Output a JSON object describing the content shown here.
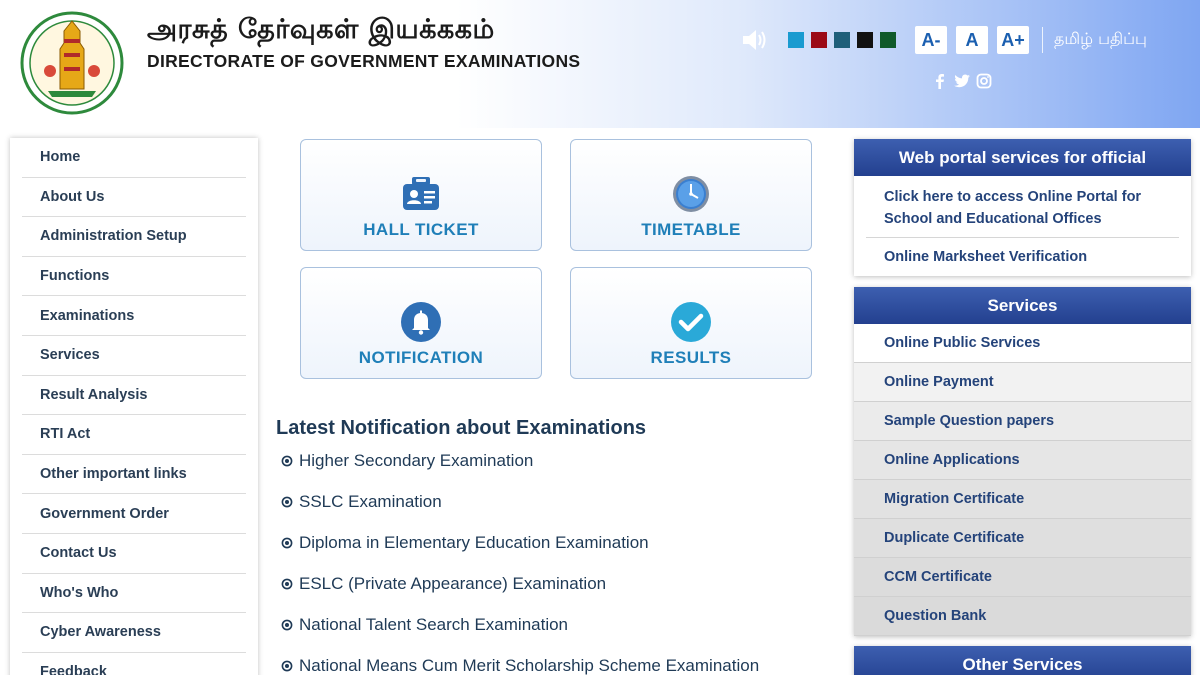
{
  "header": {
    "title_tamil": "அரசுத் தேர்வுகள் இயக்ககம்",
    "title_english": "DIRECTORATE OF GOVERNMENT EXAMINATIONS",
    "theme_swatches": [
      "#1a9bd0",
      "#9b0a16",
      "#1f5f7a",
      "#111111",
      "#0f5a2a"
    ],
    "font_decrease": "A-",
    "font_normal": "A",
    "font_increase": "A+",
    "language_toggle": "தமிழ் பதிப்பு",
    "icons": {
      "speaker": "speaker-icon",
      "facebook": "facebook-icon",
      "twitter": "twitter-icon",
      "instagram": "instagram-icon"
    }
  },
  "left_nav": {
    "items": [
      "Home",
      "About Us",
      "Administration Setup",
      "Functions",
      "Examinations",
      "Services",
      "Result Analysis",
      "RTI Act",
      "Other important links",
      "Government Order",
      "Contact Us",
      "Who's Who",
      "Cyber Awareness",
      "Feedback"
    ]
  },
  "tiles": {
    "hall_ticket": "HALL TICKET",
    "timetable": "TIMETABLE",
    "notification": "NOTIFICATION",
    "results": "RESULTS"
  },
  "latest": {
    "heading": "Latest Notification about Examinations",
    "items": [
      "Higher Secondary Examination",
      "SSLC Examination",
      "Diploma in Elementary Education Examination",
      "ESLC (Private Appearance) Examination",
      "National Talent Search Examination",
      "National Means Cum Merit Scholarship Scheme Examination"
    ]
  },
  "right_panels": {
    "web_portal": {
      "title": "Web portal services for official",
      "links": [
        "Click here to access Online Portal for School and Educational Offices",
        "Online Marksheet Verification"
      ]
    },
    "services": {
      "title": "Services",
      "links": [
        "Online Public Services",
        "Online Payment",
        "Sample Question papers",
        "Online Applications",
        "Migration Certificate",
        "Duplicate Certificate",
        "CCM Certificate",
        "Question Bank"
      ]
    },
    "other_services": {
      "title": "Other Services"
    }
  },
  "colors": {
    "header_gradient_end": "#7fa6f2",
    "panel_header": "#23408f",
    "tile_label": "#1f7fb8",
    "icon_blue": "#2f6fb5",
    "icon_teal": "#2aa9d8"
  }
}
